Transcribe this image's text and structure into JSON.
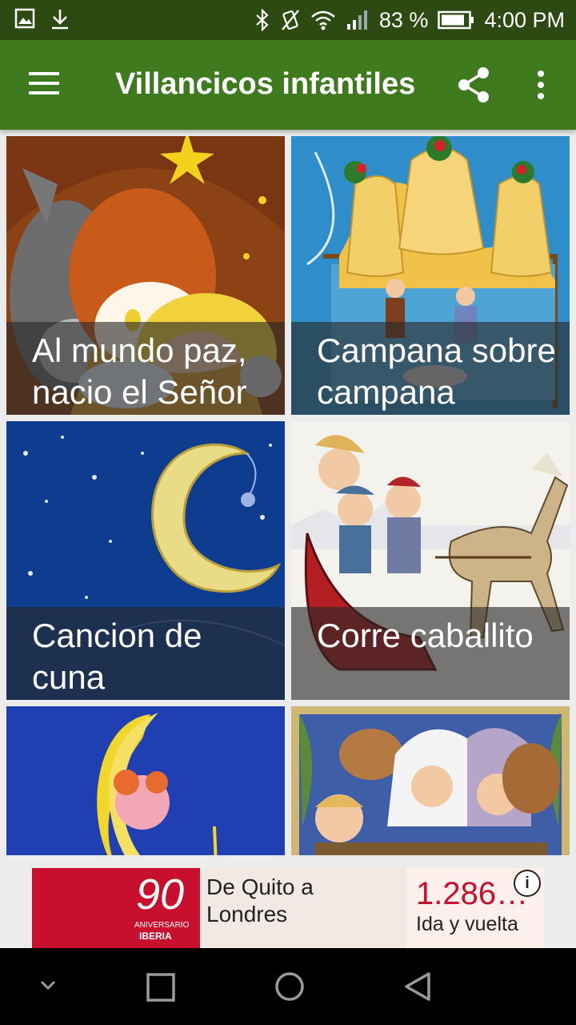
{
  "status_bar": {
    "battery_percent": "83 %",
    "time": "4:00 PM",
    "icons": [
      "gallery-icon",
      "download-icon",
      "bluetooth-icon",
      "vibrate-icon",
      "wifi-icon",
      "signal-icon",
      "battery-icon"
    ]
  },
  "toolbar": {
    "title": "Villancicos infantiles",
    "menu_icon": "hamburger-menu-icon",
    "share_icon": "share-icon",
    "more_icon": "more-vertical-icon",
    "color": "#3f7b1e"
  },
  "songs": [
    {
      "title": "Al mundo paz, nacio el Señor"
    },
    {
      "title": "Campana sobre campana"
    },
    {
      "title": "Cancion de cuna"
    },
    {
      "title": "Corre caballito"
    },
    {
      "title": ""
    },
    {
      "title": ""
    }
  ],
  "ad": {
    "logo_text": "90",
    "logo_sub1": "ANIVERSARIO",
    "logo_sub2": "IBERIA",
    "route_line1": "De Quito a",
    "route_line2": "Londres",
    "price": "1.286…",
    "trip_type": "Ida y vuelta",
    "info_icon": "info-icon"
  },
  "nav_bar": {
    "icons": [
      "collapse-icon",
      "recents-icon",
      "home-icon",
      "back-icon"
    ]
  }
}
